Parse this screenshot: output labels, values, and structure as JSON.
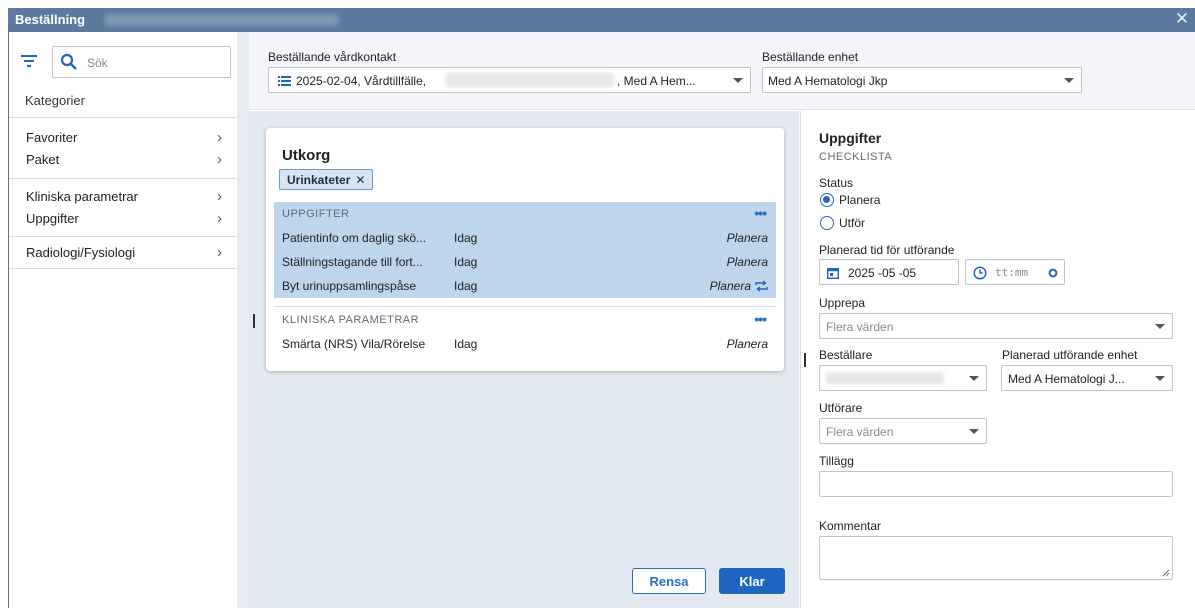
{
  "window": {
    "title": "Beställning",
    "close_icon": "close-icon"
  },
  "sidebar": {
    "search_placeholder": "Sök",
    "categories_label": "Kategorier",
    "items": [
      {
        "label": "Favoriter"
      },
      {
        "label": "Paket"
      },
      {
        "label": "Kliniska parametrar"
      },
      {
        "label": "Uppgifter"
      },
      {
        "label": "Radiologi/Fysiologi"
      }
    ]
  },
  "header": {
    "contact_label": "Beställande vårdkontakt",
    "contact_value_start": "2025-02-04, Vårdtillfälle,",
    "contact_value_end": ", Med A Hem...",
    "unit_label": "Beställande enhet",
    "unit_value": "Med A Hematologi Jkp"
  },
  "outbox": {
    "title": "Utkorg",
    "chip_label": "Urinkateter",
    "sections": [
      {
        "header": "UPPGIFTER",
        "rows": [
          {
            "name": "Patientinfo om daglig skö...",
            "when": "Idag",
            "status": "Planera"
          },
          {
            "name": "Ställningstagande till fort...",
            "when": "Idag",
            "status": "Planera"
          },
          {
            "name": "Byt urinuppsamlingspåse",
            "when": "Idag",
            "status": "Planera"
          }
        ]
      },
      {
        "header": "KLINISKA PARAMETRAR",
        "rows": [
          {
            "name": "Smärta (NRS) Vila/Rörelse",
            "when": "Idag",
            "status": "Planera"
          }
        ]
      }
    ],
    "clear_button": "Rensa",
    "done_button": "Klar"
  },
  "detail": {
    "title": "Uppgifter",
    "subtitle": "CHECKLISTA",
    "status_label": "Status",
    "status_options": [
      {
        "label": "Planera",
        "selected": true
      },
      {
        "label": "Utför",
        "selected": false
      }
    ],
    "planned_time_label": "Planerad tid för utförande",
    "date_value": "2025 -05 -05",
    "time_placeholder": "tt:mm",
    "repeat_label": "Upprepa",
    "repeat_placeholder": "Flera värden",
    "orderer_label": "Beställare",
    "planned_unit_label": "Planerad utförande enhet",
    "planned_unit_value": "Med A Hematologi J...",
    "performer_label": "Utförare",
    "performer_placeholder": "Flera värden",
    "addition_label": "Tillägg",
    "comment_label": "Kommentar"
  },
  "colors": {
    "titlebar": "#5b7a9d",
    "accent": "#1f66c1",
    "selection": "#bfd5ec",
    "panel_bg": "#e4eaf1"
  }
}
